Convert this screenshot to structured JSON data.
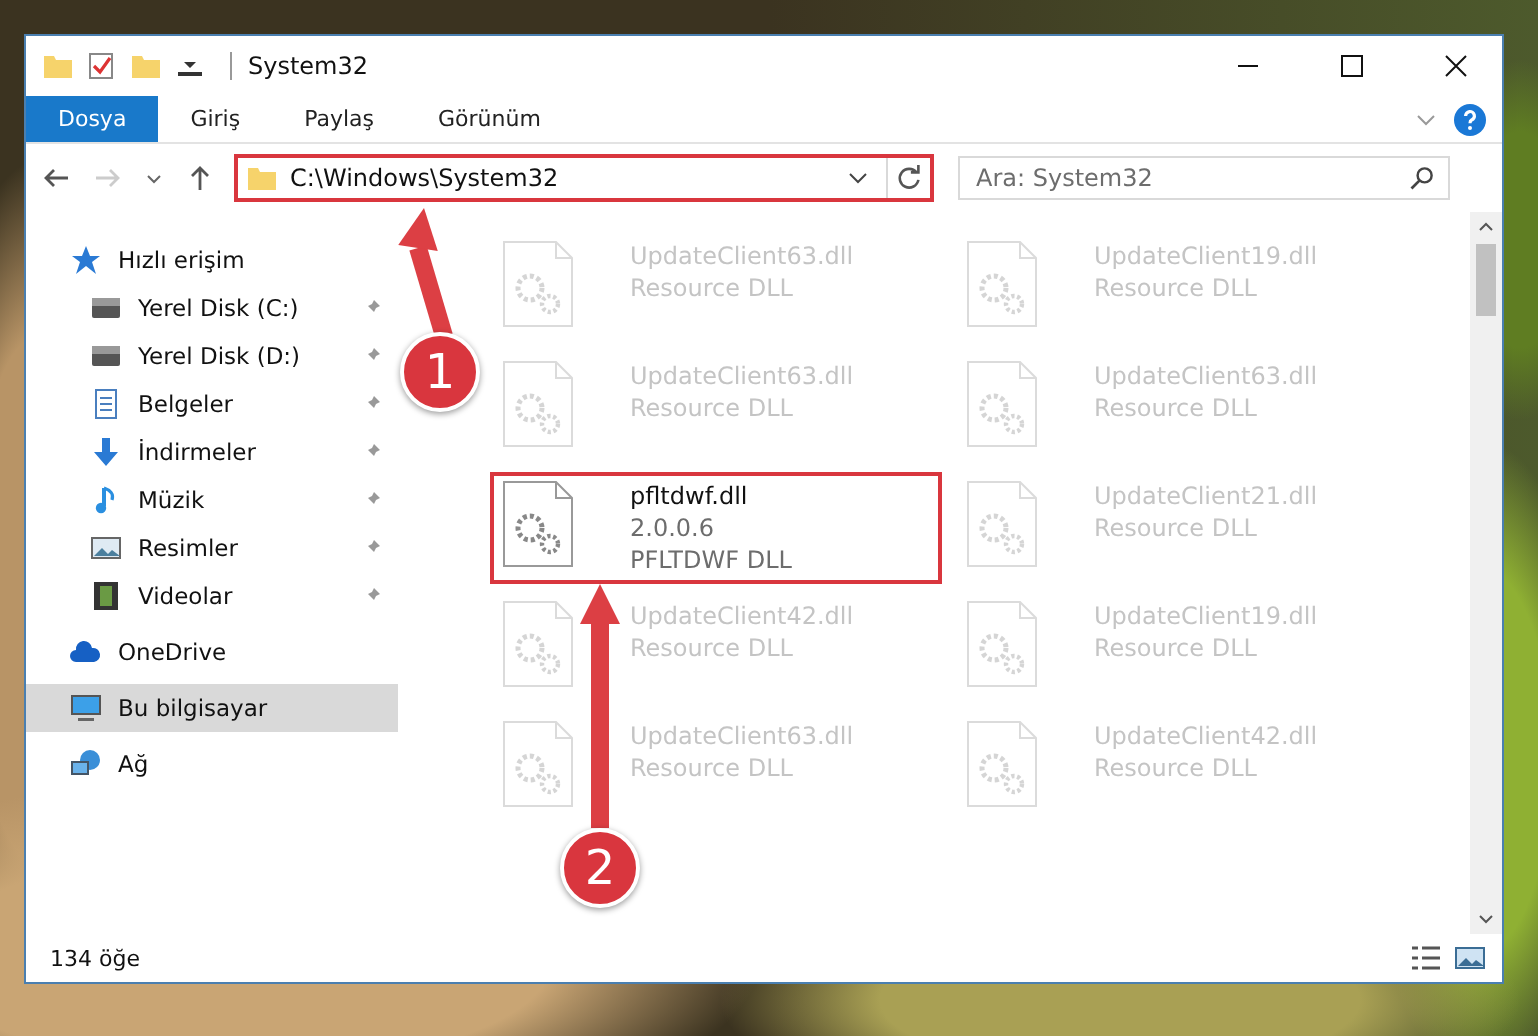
{
  "window": {
    "title": "System32"
  },
  "ribbon_tabs": [
    {
      "label": "Dosya",
      "selected": true
    },
    {
      "label": "Giriş",
      "selected": false
    },
    {
      "label": "Paylaş",
      "selected": false
    },
    {
      "label": "Görünüm",
      "selected": false
    }
  ],
  "address": {
    "path": "C:\\Windows\\System32",
    "highlighted": true
  },
  "search": {
    "placeholder": "Ara: System32"
  },
  "nav": [
    {
      "label": "Hızlı erişim",
      "kind": "star",
      "selected": false,
      "children": [
        {
          "label": "Yerel Disk (C:)",
          "kind": "drive",
          "pinned": true,
          "selected": false
        },
        {
          "label": "Yerel Disk (D:)",
          "kind": "drive",
          "pinned": true,
          "selected": false
        },
        {
          "label": "Belgeler",
          "kind": "document",
          "pinned": true,
          "selected": false
        },
        {
          "label": "İndirmeler",
          "kind": "download",
          "pinned": true,
          "selected": false
        },
        {
          "label": "Müzik",
          "kind": "music",
          "pinned": true,
          "selected": false
        },
        {
          "label": "Resimler",
          "kind": "image",
          "pinned": true,
          "selected": false
        },
        {
          "label": "Videolar",
          "kind": "video",
          "pinned": true,
          "selected": false
        }
      ]
    },
    {
      "label": "OneDrive",
      "kind": "cloud",
      "selected": false
    },
    {
      "label": "Bu bilgisayar",
      "kind": "computer",
      "selected": true
    },
    {
      "label": "Ağ",
      "kind": "network",
      "selected": false
    }
  ],
  "files": [
    {
      "name": "UpdateClient63.dll",
      "details": [
        "Resource DLL"
      ],
      "highlighted": false
    },
    {
      "name": "UpdateClient19.dll",
      "details": [
        "Resource DLL"
      ],
      "highlighted": false
    },
    {
      "name": "UpdateClient63.dll",
      "details": [
        "Resource DLL"
      ],
      "highlighted": false
    },
    {
      "name": "UpdateClient63.dll",
      "details": [
        "Resource DLL"
      ],
      "highlighted": false
    },
    {
      "name": "pfltdwf.dll",
      "details": [
        "2.0.0.6",
        "PFLTDWF DLL"
      ],
      "highlighted": true
    },
    {
      "name": "UpdateClient21.dll",
      "details": [
        "Resource DLL"
      ],
      "highlighted": false
    },
    {
      "name": "UpdateClient42.dll",
      "details": [
        "Resource DLL"
      ],
      "highlighted": false
    },
    {
      "name": "UpdateClient19.dll",
      "details": [
        "Resource DLL"
      ],
      "highlighted": false
    },
    {
      "name": "UpdateClient63.dll",
      "details": [
        "Resource DLL"
      ],
      "highlighted": false
    },
    {
      "name": "UpdateClient42.dll",
      "details": [
        "Resource DLL"
      ],
      "highlighted": false
    }
  ],
  "status_bar": {
    "item_count": "134 öğe"
  },
  "annotations": [
    {
      "label": "1"
    },
    {
      "label": "2"
    }
  ]
}
